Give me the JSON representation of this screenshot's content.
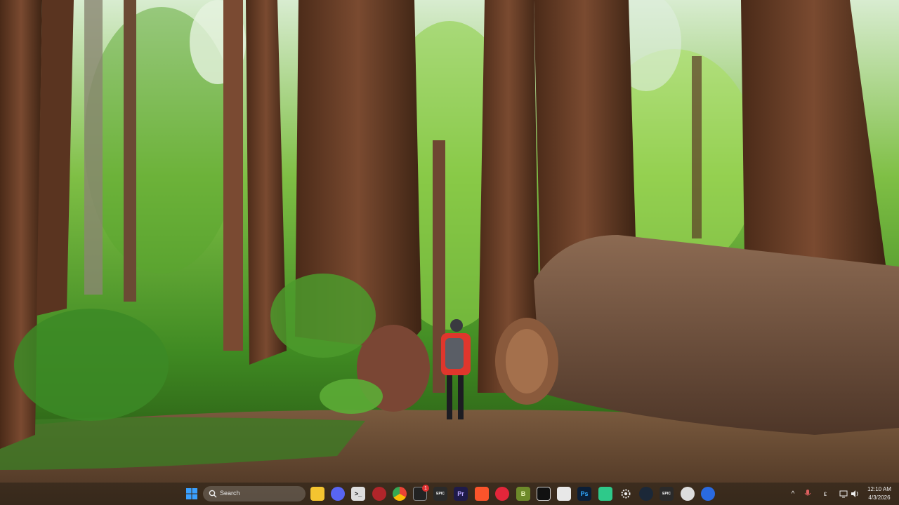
{
  "taskbar": {
    "search_placeholder": "Search",
    "notification_badge": "1",
    "apps": [
      {
        "name": "file-explorer",
        "glyph": ""
      },
      {
        "name": "discord",
        "glyph": ""
      },
      {
        "name": "terminal",
        "glyph": ">_"
      },
      {
        "name": "app-red-circle",
        "glyph": ""
      },
      {
        "name": "chrome",
        "glyph": ""
      },
      {
        "name": "notification-app",
        "glyph": ""
      },
      {
        "name": "epic-games",
        "glyph": "EPIC"
      },
      {
        "name": "premiere-pro",
        "glyph": "Pr"
      },
      {
        "name": "brave",
        "glyph": ""
      },
      {
        "name": "app-red-square",
        "glyph": ""
      },
      {
        "name": "app-green-b",
        "glyph": "B"
      },
      {
        "name": "capcut",
        "glyph": ""
      },
      {
        "name": "minecraft",
        "glyph": ""
      },
      {
        "name": "photoshop",
        "glyph": "Ps"
      },
      {
        "name": "app-green-square",
        "glyph": ""
      },
      {
        "name": "settings",
        "glyph": ""
      },
      {
        "name": "steam",
        "glyph": ""
      },
      {
        "name": "epic-games-2",
        "glyph": "EPIC"
      },
      {
        "name": "obs",
        "glyph": ""
      },
      {
        "name": "app-blue-circle",
        "glyph": ""
      }
    ],
    "tray": {
      "ime_indicator": "ε",
      "time": "12:10 AM",
      "date": "4/3/2026"
    }
  },
  "colors": {
    "taskbar_bg": "#28201680",
    "windows_blue": "#3aa0ff"
  }
}
